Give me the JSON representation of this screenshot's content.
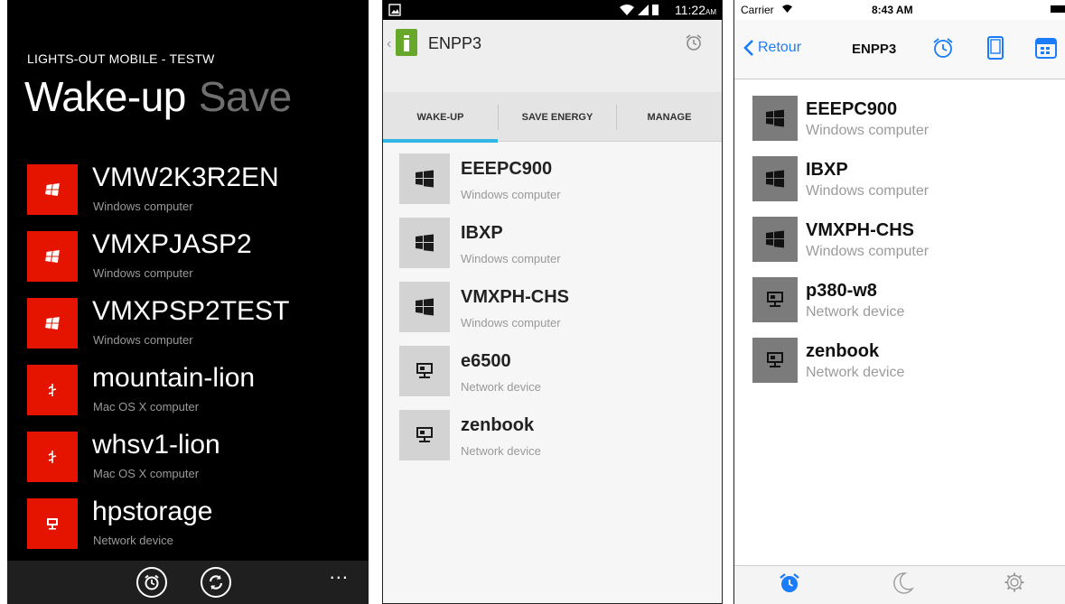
{
  "wp": {
    "app_title": "LIGHTS-OUT MOBILE - TESTW",
    "pivots": [
      "Wake-up",
      "Save"
    ],
    "devices": [
      {
        "name": "VMW2K3R2EN",
        "type": "Windows computer",
        "icon": "windows-logo-icon"
      },
      {
        "name": "VMXPJASP2",
        "type": "Windows computer",
        "icon": "windows-logo-icon"
      },
      {
        "name": "VMXPSP2TEST",
        "type": "Windows computer",
        "icon": "windows-logo-icon"
      },
      {
        "name": "mountain-lion",
        "type": "Mac OS X computer",
        "icon": "mac-logo-icon"
      },
      {
        "name": "whsv1-lion",
        "type": "Mac OS X computer",
        "icon": "mac-logo-icon"
      },
      {
        "name": "hpstorage",
        "type": "Network device",
        "icon": "network-device-icon"
      }
    ],
    "appbar": {
      "buttons": [
        "alarm-icon",
        "refresh-icon"
      ],
      "more": "..."
    },
    "colors": {
      "accent": "#e51400",
      "background": "#000000",
      "secondary_text": "#9a9a9a"
    }
  },
  "android": {
    "status": {
      "time": "11:22",
      "ampm": "AM"
    },
    "title": "ENPP3",
    "tabs": [
      "WAKE-UP",
      "SAVE ENERGY",
      "MANAGE"
    ],
    "active_tab": "WAKE-UP",
    "devices": [
      {
        "name": "EEEPC900",
        "type": "Windows computer",
        "icon": "windows-logo-icon"
      },
      {
        "name": "IBXP",
        "type": "Windows computer",
        "icon": "windows-logo-icon"
      },
      {
        "name": "VMXPH-CHS",
        "type": "Windows computer",
        "icon": "windows-logo-icon"
      },
      {
        "name": "e6500",
        "type": "Network device",
        "icon": "network-device-icon"
      },
      {
        "name": "zenbook",
        "type": "Network device",
        "icon": "network-device-icon"
      }
    ],
    "colors": {
      "tab_indicator": "#33b5e5",
      "logo": "#67a82a"
    }
  },
  "ios": {
    "status": {
      "carrier": "Carrier",
      "time": "8:43 AM"
    },
    "back_label": "Retour",
    "title": "ENPP3",
    "nav_icons": [
      "alarm-icon",
      "tablet-icon",
      "calendar-icon"
    ],
    "devices": [
      {
        "name": "EEEPC900",
        "type": "Windows computer",
        "icon": "windows-logo-icon"
      },
      {
        "name": "IBXP",
        "type": "Windows computer",
        "icon": "windows-logo-icon"
      },
      {
        "name": "VMXPH-CHS",
        "type": "Windows computer",
        "icon": "windows-logo-icon"
      },
      {
        "name": "p380-w8",
        "type": "Network device",
        "icon": "network-device-icon"
      },
      {
        "name": "zenbook",
        "type": "Network device",
        "icon": "network-device-icon"
      }
    ],
    "tabbar": [
      "alarm-icon",
      "moon-icon",
      "gear-icon"
    ],
    "colors": {
      "tint": "#1a7cf8"
    }
  }
}
